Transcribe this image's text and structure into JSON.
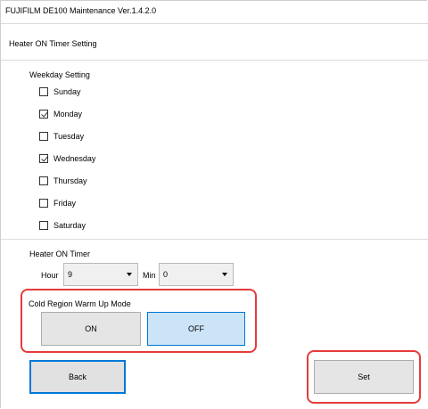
{
  "window": {
    "title": "FUJIFILM DE100 Maintenance Ver.1.4.2.0"
  },
  "header": {
    "title": "Heater ON Timer Setting"
  },
  "weekday": {
    "label": "Weekday Setting",
    "days": [
      {
        "label": "Sunday",
        "checked": false
      },
      {
        "label": "Monday",
        "checked": true
      },
      {
        "label": "Tuesday",
        "checked": false
      },
      {
        "label": "Wednesday",
        "checked": true
      },
      {
        "label": "Thursday",
        "checked": false
      },
      {
        "label": "Friday",
        "checked": false
      },
      {
        "label": "Saturday",
        "checked": false
      }
    ]
  },
  "timer": {
    "label": "Heater ON Timer",
    "hour_label": "Hour",
    "hour_value": "9",
    "min_label": "Min",
    "min_value": "0"
  },
  "cold_region": {
    "label": "Cold Region Warm Up Mode",
    "on_label": "ON",
    "off_label": "OFF",
    "selected": "OFF"
  },
  "actions": {
    "back_label": "Back",
    "set_label": "Set"
  },
  "colors": {
    "highlight": "#e63b3b",
    "selected_fill": "#cce4f7",
    "focus_border": "#0078d7"
  }
}
